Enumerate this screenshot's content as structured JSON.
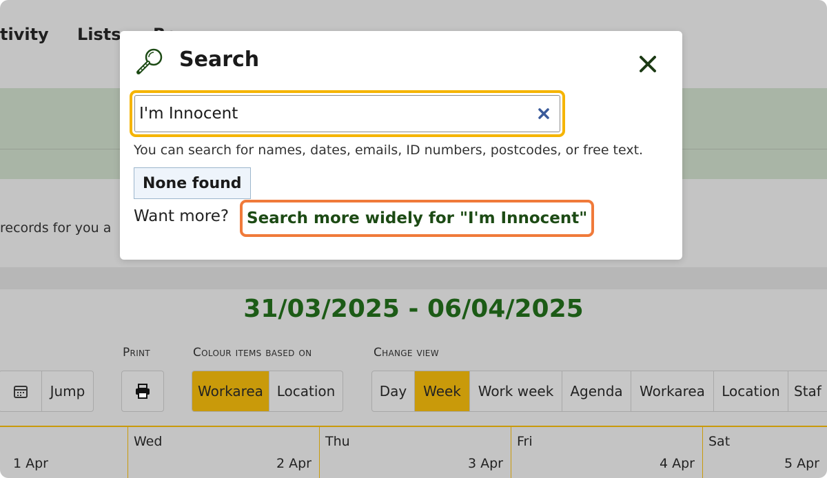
{
  "nav": {
    "items": [
      "tivity",
      "Lists",
      "Re"
    ]
  },
  "background": {
    "records_text": "records for you a",
    "date_range": "31/03/2025 - 06/04/2025"
  },
  "toolbar": {
    "jump_label": "Jump",
    "print_label": "Print",
    "colour_label": "Colour items based on",
    "colour_options": [
      "Workarea",
      "Location"
    ],
    "colour_selected": "Workarea",
    "change_view_label": "Change view",
    "view_options": [
      "Day",
      "Week",
      "Work week",
      "Agenda",
      "Workarea",
      "Location",
      "Staf"
    ],
    "view_selected": "Week"
  },
  "calendar": {
    "days": [
      {
        "name": "",
        "date": "1 Apr"
      },
      {
        "name": "Wed",
        "date": "2 Apr"
      },
      {
        "name": "Thu",
        "date": "3 Apr"
      },
      {
        "name": "Fri",
        "date": "4 Apr"
      },
      {
        "name": "Sat",
        "date": "5 Apr"
      }
    ]
  },
  "modal": {
    "title": "Search",
    "search_value": "I'm Innocent",
    "hint": "You can search for names, dates, emails, ID numbers, postcodes, or free text.",
    "none_found": "None found",
    "want_more": "Want more?",
    "search_wide_link": "Search more widely for \"I'm Innocent\"",
    "colors": {
      "focus_outline": "#f5b400",
      "link_outline": "#f07a3a",
      "link_text": "#1c4a14",
      "accent": "#c99a0a"
    }
  }
}
